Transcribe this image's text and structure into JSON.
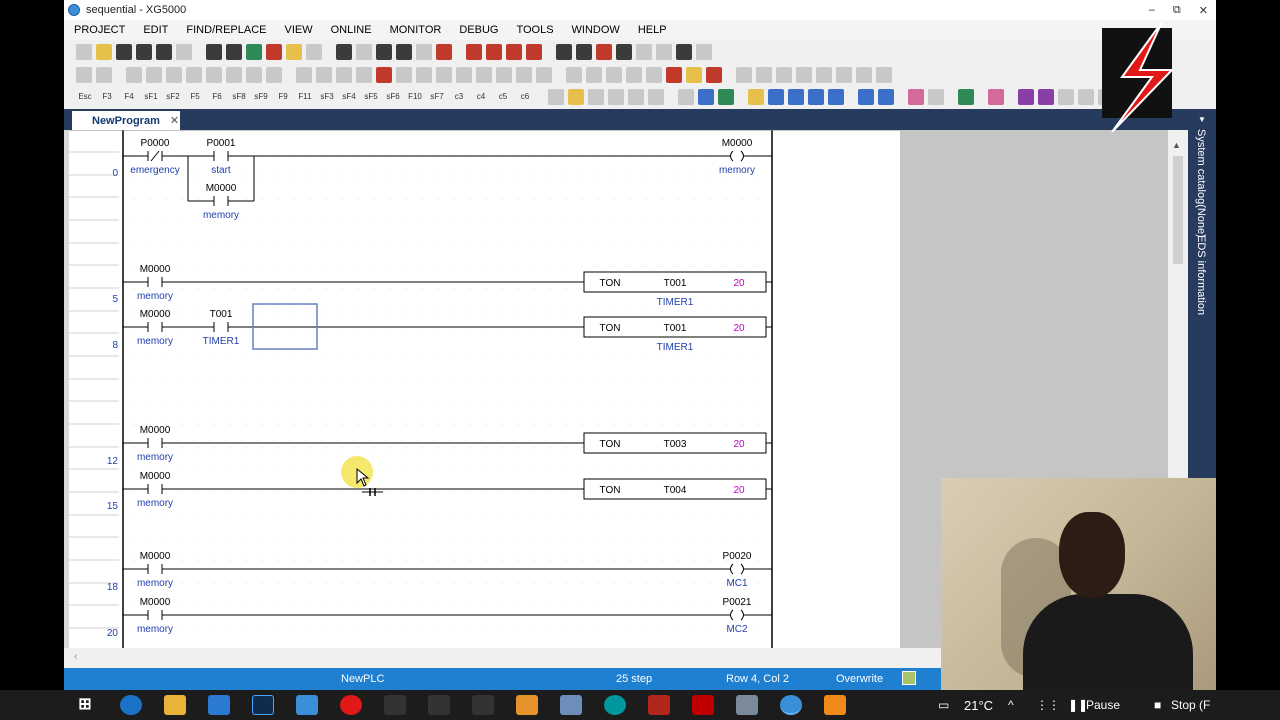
{
  "window": {
    "title": "sequential - XG5000",
    "min": "–",
    "max": "⧉",
    "close": "✕"
  },
  "menu": [
    "PROJECT",
    "EDIT",
    "FIND/REPLACE",
    "VIEW",
    "ONLINE",
    "MONITOR",
    "DEBUG",
    "TOOLS",
    "WINDOW",
    "HELP"
  ],
  "function_keys": [
    "Esc",
    "F3",
    "F4",
    "sF1",
    "sF2",
    "F5",
    "F6",
    "sF8",
    "sF9",
    "F9",
    "F11",
    "sF3",
    "sF4",
    "sF5",
    "sF6",
    "F10",
    "sF7",
    "c3",
    "c4",
    "c5",
    "c6"
  ],
  "tab": {
    "label": "NewProgram",
    "close": "✕"
  },
  "ladder": {
    "step_numbers": [
      "0",
      "5",
      "8",
      "12",
      "15",
      "18",
      "20"
    ],
    "rung0": {
      "c1_addr": "P0000",
      "c1_label": "emergency",
      "c2_addr": "P0001",
      "c2_label": "start",
      "c3_addr": "M0000",
      "c3_label": "memory",
      "coil_addr": "M0000",
      "coil_label": "memory"
    },
    "rung5": {
      "c_addr": "M0000",
      "c_label": "memory",
      "func": "TON",
      "timer": "T001",
      "preset": "20",
      "timer_label": "TIMER1"
    },
    "rung8": {
      "c1_addr": "M0000",
      "c1_label": "memory",
      "c2_addr": "T001",
      "c2_label": "TIMER1",
      "func": "TON",
      "timer": "T001",
      "preset": "20",
      "timer_label": "TIMER1"
    },
    "rung12": {
      "c_addr": "M0000",
      "c_label": "memory",
      "func": "TON",
      "timer": "T003",
      "preset": "20"
    },
    "rung15": {
      "c_addr": "M0000",
      "c_label": "memory",
      "func": "TON",
      "timer": "T004",
      "preset": "20"
    },
    "rung18": {
      "c_addr": "M0000",
      "c_label": "memory",
      "coil_addr": "P0020",
      "coil_label": "MC1"
    },
    "rung20": {
      "c_addr": "M0000",
      "c_label": "memory",
      "coil_addr": "P0021",
      "coil_label": "MC2"
    }
  },
  "sidebar": {
    "item1": "System catalog(None)",
    "item2": "EDS information"
  },
  "status": {
    "plc": "NewPLC",
    "steps": "25 step",
    "position": "Row 4, Col 2",
    "mode": "Overwrite"
  },
  "taskbar": {
    "temp": "21°C",
    "pause": "Pause",
    "stop": "Stop (F"
  },
  "colors": {
    "status_bar": "#1f7fd1",
    "tab_strip": "#263b5e",
    "preset": "#c000c0",
    "label_blue": "#1f3fa8"
  }
}
